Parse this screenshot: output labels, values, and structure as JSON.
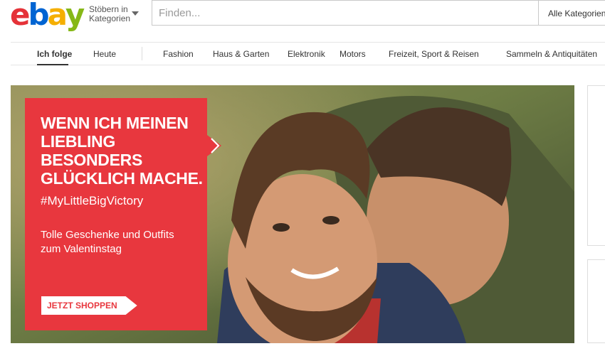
{
  "header": {
    "logo_letters": [
      "e",
      "b",
      "a",
      "y"
    ],
    "logo_colors": [
      "#e53238",
      "#0064d2",
      "#f5af02",
      "#86b817"
    ],
    "browse_line1": "Stöbern in",
    "browse_line2": "Kategorien",
    "search_placeholder": "Finden...",
    "category_select": "Alle Kategorien"
  },
  "nav": {
    "items": [
      {
        "label": "Ich folge",
        "active": true
      },
      {
        "label": "Heute"
      },
      {
        "label": "Fashion"
      },
      {
        "label": "Haus & Garten"
      },
      {
        "label": "Elektronik"
      },
      {
        "label": "Motors"
      },
      {
        "label": "Freizeit, Sport & Reisen"
      },
      {
        "label": "Sammeln & Antiquitäten"
      }
    ]
  },
  "hero": {
    "headline": "WENN ICH MEINEN LIEBLING BESONDERS GLÜCKLICH MACHE.",
    "hashtag": "#MyLittleBigVictory",
    "subtext": "Tolle Geschenke und Outfits zum Valentinstag",
    "cta": "JETZT SHOPPEN",
    "promo_color": "#e8373e"
  }
}
